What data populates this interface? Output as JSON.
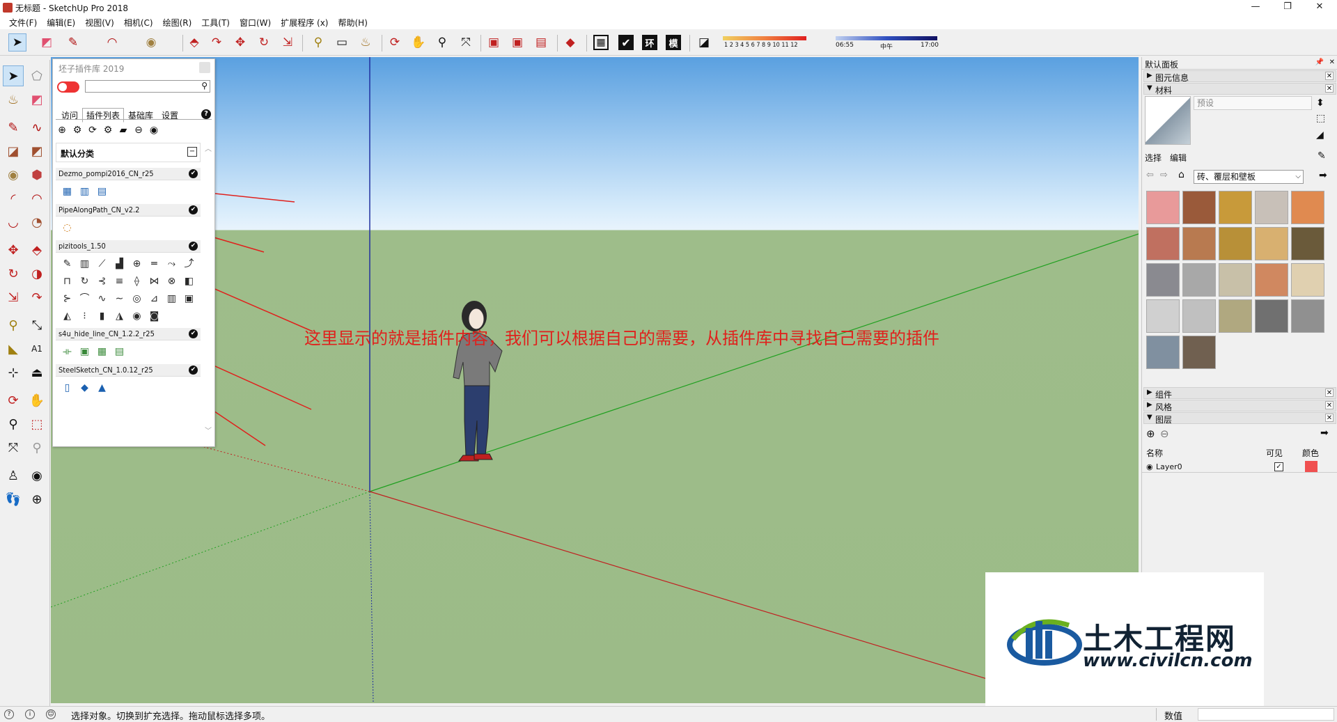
{
  "window": {
    "title": "无标题 - SketchUp Pro 2018",
    "controls": [
      "—",
      "❐",
      "✕"
    ]
  },
  "menubar": {
    "items": [
      "文件(F)",
      "编辑(E)",
      "视图(V)",
      "相机(C)",
      "绘图(R)",
      "工具(T)",
      "窗口(W)",
      "扩展程序 (x)",
      "帮助(H)"
    ]
  },
  "shadow_bar": {
    "months": "1 2 3 4 5 6 7 8 9 10 11 12",
    "time_start": "06:55",
    "time_mid": "中午",
    "time_end": "17:00"
  },
  "toolbar_text_buttons": [
    "环",
    "模"
  ],
  "plugin_panel": {
    "title": "坯子插件库 2019",
    "tabs": [
      "访问",
      "插件列表",
      "基础库",
      "设置"
    ],
    "active_tab": "插件列表",
    "help": "?",
    "category": "默认分类",
    "groups": [
      {
        "name": "Dezmo_pompi2016_CN_r25",
        "icons": [
          "▦",
          "▥",
          "▤"
        ]
      },
      {
        "name": "PipeAlongPath_CN_v2.2",
        "icons": [
          "◌"
        ]
      },
      {
        "name": "pizitools_1.50",
        "icons": [
          "✎",
          "▥",
          "⟋",
          "▟",
          "⊕",
          "═",
          "⤳",
          "⤴",
          "⊓",
          "↻",
          "⊰",
          "≡",
          "⟠",
          "⋈",
          "⊗",
          "◧",
          "⊱",
          "⌒",
          "∿",
          "∼",
          "◎",
          "⊿",
          "▥",
          "▣",
          "◭",
          "⁝",
          "▮",
          "◮",
          "◉",
          "◙"
        ]
      },
      {
        "name": "s4u_hide_line_CN_1.2.2_r25",
        "icons": [
          "⟛",
          "▣",
          "▦",
          "▤"
        ]
      },
      {
        "name": "SteelSketch_CN_1.0.12_r25",
        "icons": [
          "▯",
          "◆",
          "▲"
        ]
      }
    ]
  },
  "annotation": "这里显示的就是插件内容，我们可以根据自己的需要，从插件库中寻找自己需要的插件",
  "tray": {
    "title": "默认面板",
    "sections_top": [
      {
        "label": "图元信息",
        "expanded": false
      },
      {
        "label": "材料",
        "expanded": true
      }
    ],
    "material_name": "预设",
    "material_tabs": [
      "选择",
      "编辑"
    ],
    "material_collection": "砖、覆层和壁板",
    "swatch_colors": [
      "#e89a9a",
      "#9a5a3a",
      "#c89a3a",
      "#c8c0b8",
      "#e08a50",
      "#c07060",
      "#b87a50",
      "#b89038",
      "#d8b070",
      "#6a5a3a",
      "#8a8a90",
      "#a8a8a8",
      "#c8c0a8",
      "#d08860",
      "#e0d0b0",
      "#d0d0d0",
      "#c0c0c0",
      "#b0a880",
      "#707070",
      "#909090",
      "#8090a0",
      "#706050"
    ],
    "sections_bottom": [
      {
        "label": "组件",
        "expanded": false
      },
      {
        "label": "风格",
        "expanded": false
      },
      {
        "label": "图层",
        "expanded": true
      }
    ],
    "layers": {
      "col_name": "名称",
      "col_visible": "可见",
      "col_color": "颜色",
      "rows": [
        {
          "name": "Layer0",
          "visible": true,
          "color": "#f05050"
        }
      ]
    }
  },
  "watermark": {
    "name": "土木工程网",
    "url": "www.civilcn.com"
  },
  "statusbar": {
    "text": "选择对象。切换到扩充选择。拖动鼠标选择多项。",
    "value_label": "数值"
  }
}
